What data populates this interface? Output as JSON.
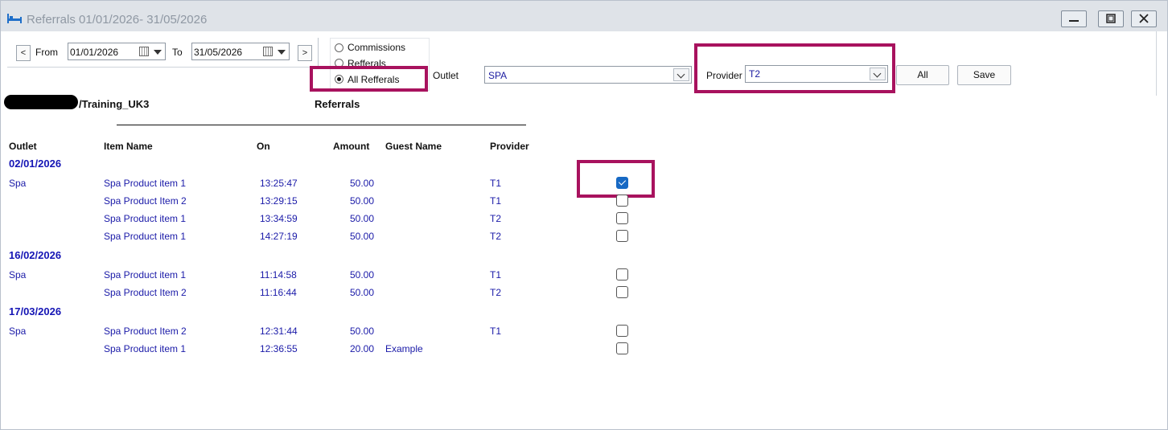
{
  "window": {
    "title": "Referrals 01/01/2026- 31/05/2026"
  },
  "toolbar": {
    "prev_label": "<",
    "next_label": ">",
    "from_label": "From",
    "from_value": "01/01/2026",
    "to_label": "To",
    "to_value": "31/05/2026",
    "radio_options": [
      "Commissions",
      "Refferals",
      "All Refferals"
    ],
    "radio_selected": "All Refferals",
    "outlet_label": "Outlet",
    "outlet_value": "SPA",
    "provider_label": "Provider",
    "provider_value": "T2",
    "all_button": "All",
    "save_button": "Save"
  },
  "report": {
    "path_text": "/Training_UK3",
    "title": "Referrals",
    "columns": [
      "Outlet",
      "Item Name",
      "On",
      "Amount",
      "Guest Name",
      "Provider"
    ],
    "groups": [
      {
        "date": "02/01/2026",
        "rows": [
          {
            "outlet": "Spa",
            "item": "Spa Product item 1",
            "on": "13:25:47",
            "amount": "50.00",
            "guest": "",
            "provider": "T1",
            "checked": true
          },
          {
            "outlet": "",
            "item": "Spa Product Item 2",
            "on": "13:29:15",
            "amount": "50.00",
            "guest": "",
            "provider": "T1",
            "checked": false
          },
          {
            "outlet": "",
            "item": "Spa Product item 1",
            "on": "13:34:59",
            "amount": "50.00",
            "guest": "",
            "provider": "T2",
            "checked": false
          },
          {
            "outlet": "",
            "item": "Spa Product item 1",
            "on": "14:27:19",
            "amount": "50.00",
            "guest": "",
            "provider": "T2",
            "checked": false
          }
        ]
      },
      {
        "date": "16/02/2026",
        "rows": [
          {
            "outlet": "Spa",
            "item": "Spa Product item 1",
            "on": "11:14:58",
            "amount": "50.00",
            "guest": "",
            "provider": "T1",
            "checked": false
          },
          {
            "outlet": "",
            "item": "Spa Product Item 2",
            "on": "11:16:44",
            "amount": "50.00",
            "guest": "",
            "provider": "T2",
            "checked": false
          }
        ]
      },
      {
        "date": "17/03/2026",
        "rows": [
          {
            "outlet": "Spa",
            "item": "Spa Product Item 2",
            "on": "12:31:44",
            "amount": "50.00",
            "guest": "",
            "provider": "T1",
            "checked": false
          },
          {
            "outlet": "",
            "item": "Spa Product item 1",
            "on": "12:36:55",
            "amount": "20.00",
            "guest": "Example",
            "provider": "",
            "checked": false
          }
        ]
      }
    ]
  },
  "icons": {
    "app": "bed-icon",
    "calendar": "calendar-icon",
    "dropdown": "chevron-down-icon",
    "minimize": "minimize-icon",
    "maximize": "maximize-icon",
    "close": "close-icon"
  },
  "colors": {
    "highlight": "#a8125e",
    "link_text": "#1a1aa8",
    "date_header": "#1515b5",
    "checkbox_on": "#1769c4"
  }
}
